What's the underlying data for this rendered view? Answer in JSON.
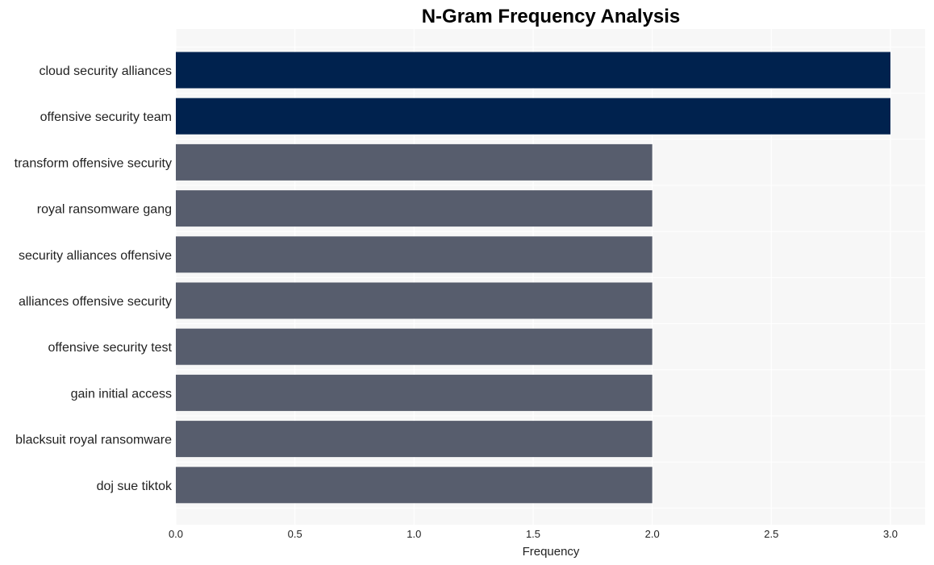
{
  "chart_data": {
    "type": "bar",
    "orientation": "horizontal",
    "title": "N-Gram Frequency Analysis",
    "xlabel": "Frequency",
    "ylabel": "",
    "xlim": [
      0,
      3.15
    ],
    "xticks": [
      0.0,
      0.5,
      1.0,
      1.5,
      2.0,
      2.5,
      3.0
    ],
    "xtick_labels": [
      "0.0",
      "0.5",
      "1.0",
      "1.5",
      "2.0",
      "2.5",
      "3.0"
    ],
    "grid": true,
    "categories": [
      "cloud security alliances",
      "offensive security team",
      "transform offensive security",
      "royal ransomware gang",
      "security alliances offensive",
      "alliances offensive security",
      "offensive security test",
      "gain initial access",
      "blacksuit royal ransomware",
      "doj sue tiktok"
    ],
    "values": [
      3,
      3,
      2,
      2,
      2,
      2,
      2,
      2,
      2,
      2
    ],
    "colors": {
      "highlight": "#00224e",
      "default": "#575d6d",
      "panel_bg": "#f7f7f7",
      "grid": "#ffffff"
    }
  }
}
